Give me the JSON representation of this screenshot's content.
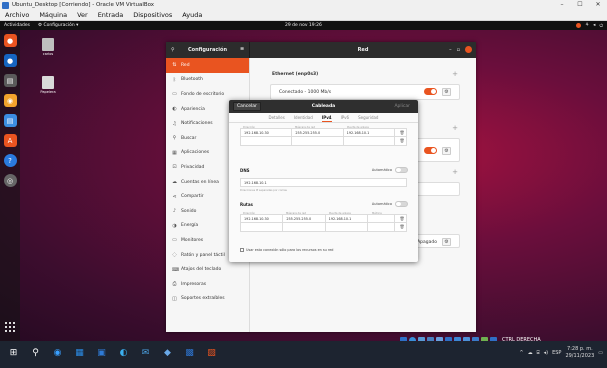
{
  "vbox": {
    "title": "Ubuntu_Desktop [Corriendo] - Oracle VM VirtualBox",
    "win_min": "–",
    "win_max": "☐",
    "win_close": "✕",
    "menu": [
      "Archivo",
      "Máquina",
      "Ver",
      "Entrada",
      "Dispositivos",
      "Ayuda"
    ],
    "status_right": "CTRL DERECHA"
  },
  "ubuntu_topbar": {
    "activities": "Actividades",
    "app_menu": "⚙ Configuración ▾",
    "clock": "29 de nov  19:26"
  },
  "desktop": {
    "icons": [
      {
        "label": "carlos"
      },
      {
        "label": "Papelera"
      }
    ]
  },
  "settings": {
    "sidebar_title": "Configuración",
    "main_title": "Red",
    "sidebar_items": [
      {
        "label": "Red",
        "icon": "network-icon"
      },
      {
        "label": "Bluetooth",
        "icon": "bluetooth-icon"
      },
      {
        "label": "Fondo de escritorio",
        "icon": "background-icon"
      },
      {
        "label": "Apariencia",
        "icon": "appearance-icon"
      },
      {
        "label": "Notificaciones",
        "icon": "bell-icon"
      },
      {
        "label": "Buscar",
        "icon": "search-icon"
      },
      {
        "label": "Aplicaciones",
        "icon": "apps-icon"
      },
      {
        "label": "Privacidad",
        "icon": "lock-icon"
      },
      {
        "label": "Cuentas en línea",
        "icon": "cloud-icon"
      },
      {
        "label": "Compartir",
        "icon": "share-icon"
      },
      {
        "label": "Sonido",
        "icon": "music-icon"
      },
      {
        "label": "Energía",
        "icon": "power-icon"
      },
      {
        "label": "Monitores",
        "icon": "monitor-icon"
      },
      {
        "label": "Ratón y panel táctil",
        "icon": "mouse-icon"
      },
      {
        "label": "Atajos del teclado",
        "icon": "keyboard-icon"
      },
      {
        "label": "Impresoras",
        "icon": "printer-icon"
      },
      {
        "label": "Soportes extraíbles",
        "icon": "media-icon"
      }
    ],
    "ethernet_title": "Ethernet (enp0s3)",
    "ethernet_status": "Conectado - 1000 Mb/s",
    "proxy_button": "Apagado"
  },
  "dialog": {
    "cancel": "Cancelar",
    "title": "Cableada",
    "apply": "Aplicar",
    "tabs": [
      "Detalles",
      "Identidad",
      "IPv4",
      "IPv6",
      "Seguridad"
    ],
    "active_tab": "IPv4",
    "addr_headers": [
      "Dirección",
      "Máscara de red",
      "Puerta de enlace"
    ],
    "addr_row": [
      "192.168.10.30",
      "255.255.255.0",
      "192.168.10.1"
    ],
    "dns_label": "DNS",
    "dns_auto": "Automático",
    "dns_value": "192.168.10.1",
    "dns_hint": "Direcciones IP separadas por comas",
    "routes_label": "Rutas",
    "routes_auto": "Automático",
    "route_headers": [
      "Dirección",
      "Máscara de red",
      "Puerta de enlace",
      "Métrica"
    ],
    "route_row": [
      "192.168.10.30",
      "255.255.255.0",
      "192.168.10.1",
      ""
    ],
    "checkbox_label": "Usar esta conexión sólo para los recursos en su red"
  },
  "taskbar": {
    "time": "7:28 p. m.",
    "date": "29/11/2023",
    "lang": "ESP"
  },
  "colors": {
    "ubuntu_orange": "#e95420",
    "header_dark": "#2c2c2c"
  }
}
